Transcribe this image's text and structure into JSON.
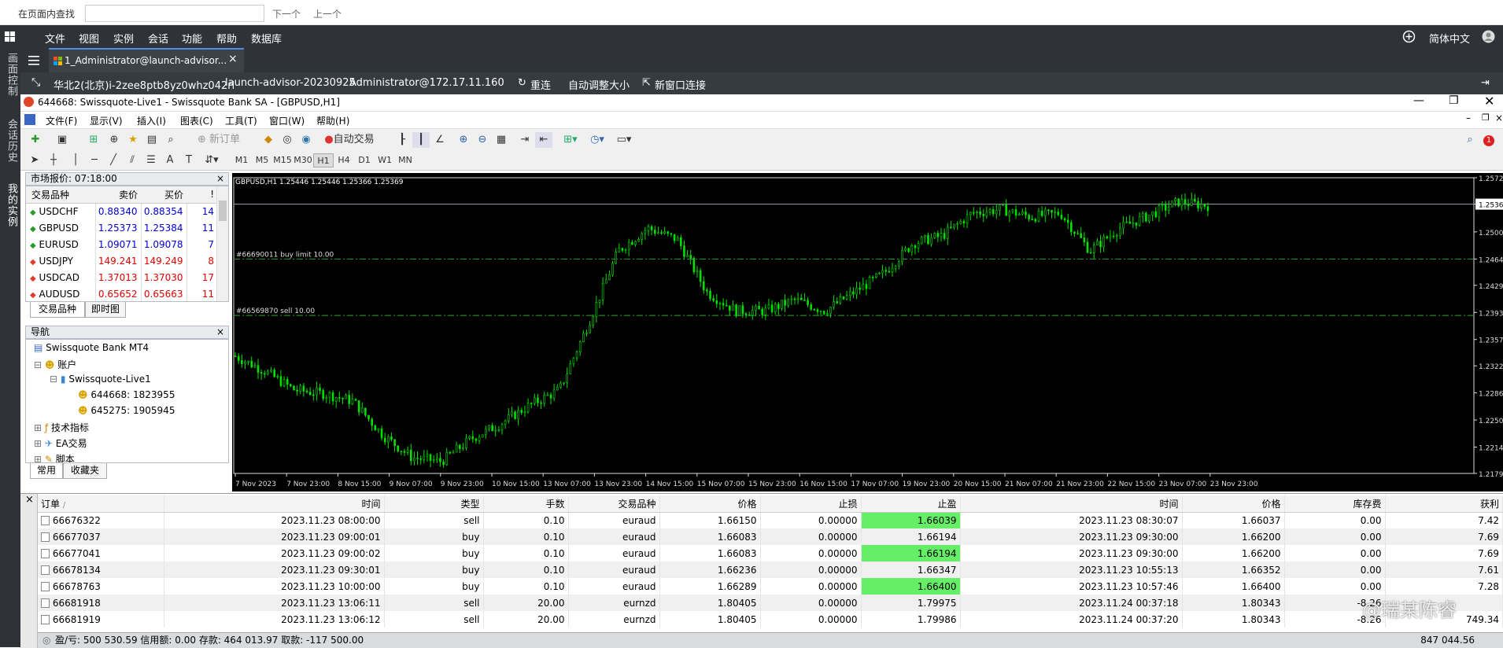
{
  "find_bar": {
    "label": "在页面内查找",
    "input_value": "",
    "next": "下一个",
    "prev": "上一个"
  },
  "host_menu": {
    "items": [
      "文件",
      "视图",
      "实例",
      "会话",
      "功能",
      "帮助",
      "数据库"
    ],
    "language": "简体中文"
  },
  "left_strip": {
    "items": [
      "画面控制",
      "会话历史",
      "我的实例"
    ]
  },
  "tab": {
    "label": "1_Administrator@launch-advisor..."
  },
  "info_bar": {
    "region": "华北2(北京)i-2zee8ptb8yz0whz042rl",
    "instance": "launch-advisor-20230925",
    "user": "Administrator@172.17.11.160",
    "reconnect": "重连",
    "auto_resize": "自动调整大小",
    "new_window": "新窗口连接"
  },
  "mt4": {
    "title": "644668: Swissquote-Live1 - Swissquote Bank SA - [GBPUSD,H1]",
    "menu": [
      "文件(F)",
      "显示(V)",
      "插入(I)",
      "图表(C)",
      "工具(T)",
      "窗口(W)",
      "帮助(H)"
    ],
    "toolbar": {
      "new_order": "新订单",
      "auto_trading": "自动交易"
    },
    "timeframes": [
      "M1",
      "M5",
      "M15",
      "M30",
      "H1",
      "H4",
      "D1",
      "W1",
      "MN"
    ],
    "selected_timeframe": "H1"
  },
  "market_watch": {
    "title": "市场报价: 07:18:00",
    "headers": [
      "交易品种",
      "卖价",
      "买价",
      "!"
    ],
    "rows": [
      {
        "symbol": "USDCHF",
        "bid": "0.88340",
        "ask": "0.88354",
        "spread": "14",
        "dir": "up"
      },
      {
        "symbol": "GBPUSD",
        "bid": "1.25373",
        "ask": "1.25384",
        "spread": "11",
        "dir": "up"
      },
      {
        "symbol": "EURUSD",
        "bid": "1.09071",
        "ask": "1.09078",
        "spread": "7",
        "dir": "up"
      },
      {
        "symbol": "USDJPY",
        "bid": "149.241",
        "ask": "149.249",
        "spread": "8",
        "dir": "down"
      },
      {
        "symbol": "USDCAD",
        "bid": "1.37013",
        "ask": "1.37030",
        "spread": "17",
        "dir": "down"
      },
      {
        "symbol": "AUDUSD",
        "bid": "0.65652",
        "ask": "0.65663",
        "spread": "11",
        "dir": "down"
      }
    ],
    "tabs": [
      "交易品种",
      "即时图"
    ]
  },
  "navigator": {
    "title": "导航",
    "root": "Swissquote Bank MT4",
    "accounts": "账户",
    "server": "Swissquote-Live1",
    "acc1": "644668: 1823955",
    "acc2": "645275: 1905945",
    "indicators": "技术指标",
    "ea": "EA交易",
    "scripts": "脚本",
    "tabs": [
      "常用",
      "收藏夹"
    ]
  },
  "chart": {
    "header": "GBPUSD,H1  1.25446 1.25446 1.25366 1.25369",
    "line1_label": "#66690011 buy limit 10.00",
    "line2_label": "#66569870 sell 10.00",
    "current_price": "1.25369"
  },
  "chart_data": {
    "type": "line",
    "title": "GBPUSD,H1  1.25446 1.25446 1.25366 1.25369",
    "xlabel": "",
    "ylabel": "",
    "ylim": [
      1.2179,
      1.2572
    ],
    "x": [
      "7 Nov 2023",
      "7 Nov 23:00",
      "8 Nov 15:00",
      "9 Nov 07:00",
      "9 Nov 23:00",
      "10 Nov 15:00",
      "13 Nov 07:00",
      "13 Nov 23:00",
      "14 Nov 15:00",
      "15 Nov 07:00",
      "15 Nov 23:00",
      "16 Nov 15:00",
      "17 Nov 07:00",
      "19 Nov 23:00",
      "20 Nov 15:00",
      "21 Nov 07:00",
      "21 Nov 23:00",
      "22 Nov 15:00",
      "23 Nov 07:00",
      "23 Nov 23:00"
    ],
    "yticks": [
      "1.25720",
      "1.25369",
      "1.25000",
      "1.24640",
      "1.24290",
      "1.23930",
      "1.23570",
      "1.23220",
      "1.22860",
      "1.22500",
      "1.22140",
      "1.21790"
    ],
    "series": [
      {
        "values": [
          1.2335,
          1.2315,
          1.229,
          1.2285,
          1.2275,
          1.223,
          1.22,
          1.2195,
          1.2225,
          1.2245,
          1.227,
          1.229,
          1.238,
          1.2475,
          1.2505,
          1.249,
          1.242,
          1.2395,
          1.2395,
          1.241,
          1.2395,
          1.242,
          1.2445,
          1.2485,
          1.2495,
          1.2525,
          1.253,
          1.252,
          1.2525,
          1.2475,
          1.2505,
          1.2522,
          1.254,
          1.2535
        ]
      }
    ],
    "hlines": [
      {
        "label": "#66690011 buy limit 10.00",
        "value": 1.2464
      },
      {
        "label": "#66569870 sell 10.00",
        "value": 1.2389
      }
    ]
  },
  "terminal": {
    "headers": [
      "订单",
      "时间",
      "类型",
      "手数",
      "交易品种",
      "价格",
      "止损",
      "止盈",
      "时间",
      "价格",
      "库存费",
      "获利"
    ],
    "rows": [
      {
        "order": "66676322",
        "open_time": "2023.11.23 08:00:00",
        "type": "sell",
        "lots": "0.10",
        "symbol": "euraud",
        "price": "1.66150",
        "sl": "0.00000",
        "tp": "1.66039",
        "close_time": "2023.11.23 08:30:07",
        "close_price": "1.66037",
        "swap": "0.00",
        "profit": "7.42",
        "tp_hit": true
      },
      {
        "order": "66677037",
        "open_time": "2023.11.23 09:00:01",
        "type": "buy",
        "lots": "0.10",
        "symbol": "euraud",
        "price": "1.66083",
        "sl": "0.00000",
        "tp": "1.66194",
        "close_time": "2023.11.23 09:30:00",
        "close_price": "1.66200",
        "swap": "0.00",
        "profit": "7.69",
        "tp_hit": true
      },
      {
        "order": "66677041",
        "open_time": "2023.11.23 09:00:02",
        "type": "buy",
        "lots": "0.10",
        "symbol": "euraud",
        "price": "1.66083",
        "sl": "0.00000",
        "tp": "1.66194",
        "close_time": "2023.11.23 09:30:00",
        "close_price": "1.66200",
        "swap": "0.00",
        "profit": "7.69",
        "tp_hit": true
      },
      {
        "order": "66678134",
        "open_time": "2023.11.23 09:30:01",
        "type": "buy",
        "lots": "0.10",
        "symbol": "euraud",
        "price": "1.66236",
        "sl": "0.00000",
        "tp": "1.66347",
        "close_time": "2023.11.23 10:55:13",
        "close_price": "1.66352",
        "swap": "0.00",
        "profit": "7.61",
        "tp_hit": true
      },
      {
        "order": "66678763",
        "open_time": "2023.11.23 10:00:00",
        "type": "buy",
        "lots": "0.10",
        "symbol": "euraud",
        "price": "1.66289",
        "sl": "0.00000",
        "tp": "1.66400",
        "close_time": "2023.11.23 10:57:46",
        "close_price": "1.66400",
        "swap": "0.00",
        "profit": "7.28",
        "tp_hit": true
      },
      {
        "order": "66681918",
        "open_time": "2023.11.23 13:06:11",
        "type": "sell",
        "lots": "20.00",
        "symbol": "eurnzd",
        "price": "1.80405",
        "sl": "0.00000",
        "tp": "1.79975",
        "close_time": "2023.11.24 00:37:18",
        "close_price": "1.80343",
        "swap": "-8.26",
        "profit": "",
        "tp_hit": false
      },
      {
        "order": "66681919",
        "open_time": "2023.11.23 13:06:12",
        "type": "sell",
        "lots": "20.00",
        "symbol": "eurnzd",
        "price": "1.80405",
        "sl": "0.00000",
        "tp": "1.79986",
        "close_time": "2023.11.24 00:37:20",
        "close_price": "1.80343",
        "swap": "-8.26",
        "profit": "749.34",
        "tp_hit": false
      }
    ],
    "summary": "盈/亏: 500 530.59  信用额: 0.00  存款: 464 013.97  取款: -117 500.00",
    "total": "847 044.56"
  },
  "watermark": "@瑞某陈睿",
  "colors": {
    "chart_bg": "#000000",
    "candle": "#00e000",
    "tp_highlight": "#66ee66",
    "host_dark": "#2f3237"
  }
}
